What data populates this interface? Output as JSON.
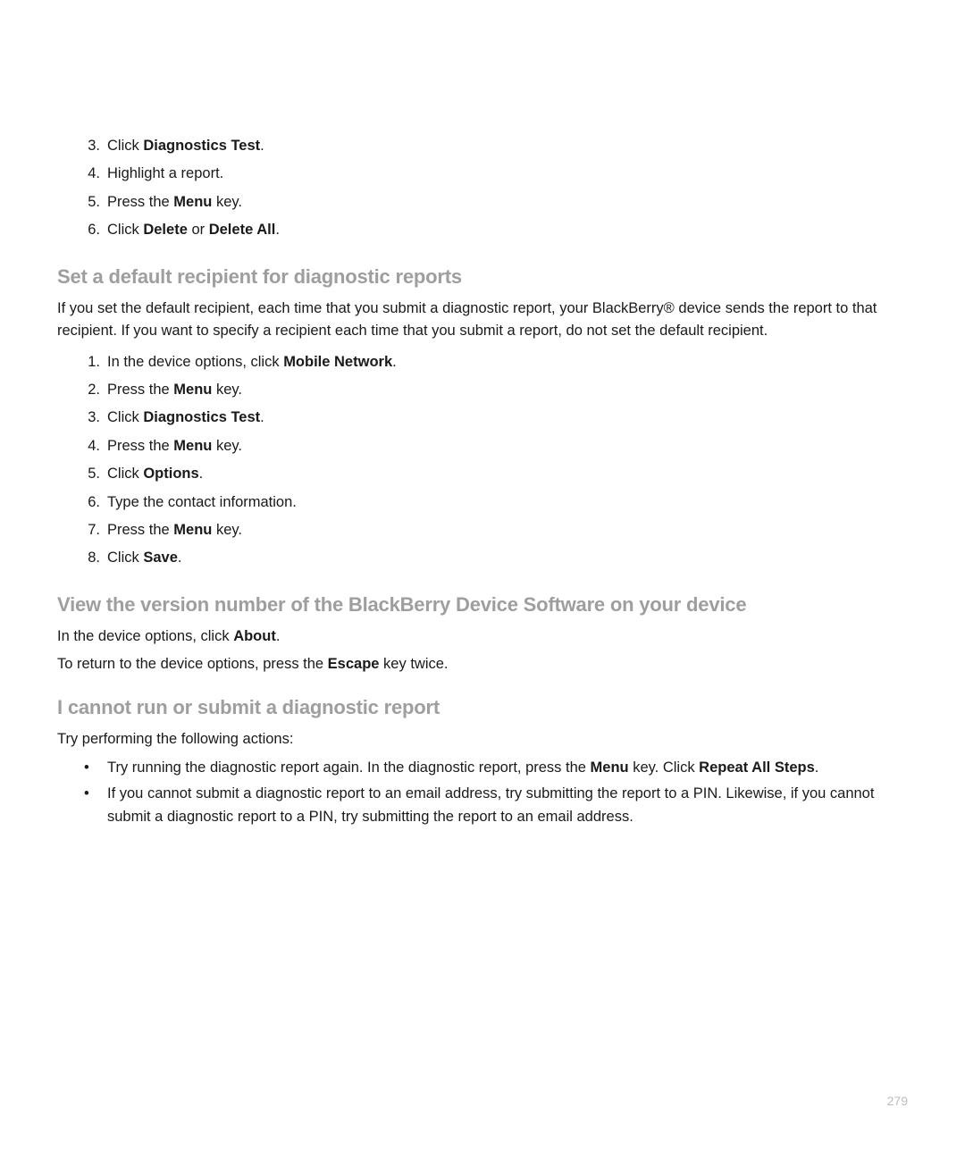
{
  "list1": [
    {
      "n": "3.",
      "pre": "Click ",
      "bold": "Diagnostics Test",
      "post": "."
    },
    {
      "n": "4.",
      "pre": "Highlight a report.",
      "bold": "",
      "post": ""
    },
    {
      "n": "5.",
      "pre": "Press the ",
      "bold": "Menu",
      "post": " key."
    },
    {
      "n": "6.",
      "pre": "Click ",
      "bold": "Delete",
      "mid": " or ",
      "bold2": "Delete All",
      "post": "."
    }
  ],
  "section1": {
    "heading": "Set a default recipient for diagnostic reports",
    "intro": "If you set the default recipient, each time that you submit a diagnostic report, your BlackBerry® device sends the report to that recipient. If you want to specify a recipient each time that you submit a report, do not set the default recipient.",
    "steps": [
      {
        "n": "1.",
        "pre": "In the device options, click ",
        "bold": "Mobile Network",
        "post": "."
      },
      {
        "n": "2.",
        "pre": "Press the ",
        "bold": "Menu",
        "post": " key."
      },
      {
        "n": "3.",
        "pre": "Click ",
        "bold": "Diagnostics Test",
        "post": "."
      },
      {
        "n": "4.",
        "pre": "Press the ",
        "bold": "Menu",
        "post": " key."
      },
      {
        "n": "5.",
        "pre": "Click ",
        "bold": "Options",
        "post": "."
      },
      {
        "n": "6.",
        "pre": "Type the contact information.",
        "bold": "",
        "post": ""
      },
      {
        "n": "7.",
        "pre": "Press the ",
        "bold": "Menu",
        "post": " key."
      },
      {
        "n": "8.",
        "pre": "Click ",
        "bold": "Save",
        "post": "."
      }
    ]
  },
  "section2": {
    "heading": "View the version number of the BlackBerry Device Software on your device",
    "line1_pre": "In the device options, click ",
    "line1_bold": "About",
    "line1_post": ".",
    "line2_pre": "To return to the device options, press the ",
    "line2_bold": "Escape",
    "line2_post": " key twice."
  },
  "section3": {
    "heading": "I cannot run or submit a diagnostic report",
    "intro": "Try performing the following actions:",
    "bullets": [
      {
        "parts": [
          "Try running the diagnostic report again. In the diagnostic report, press the ",
          {
            "b": "Menu"
          },
          " key. Click ",
          {
            "b": "Repeat All Steps"
          },
          "."
        ]
      },
      {
        "parts": [
          "If you cannot submit a diagnostic report to an email address, try submitting the report to a PIN. Likewise, if you cannot submit a diagnostic report to a PIN, try submitting the report to an email address."
        ]
      }
    ]
  },
  "pageNumber": "279"
}
